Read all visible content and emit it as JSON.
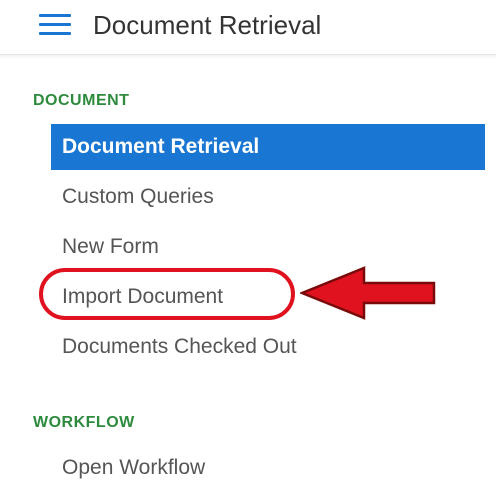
{
  "header": {
    "title": "Document Retrieval",
    "menu_icon": "hamburger-menu-icon"
  },
  "sections": [
    {
      "heading": "DOCUMENT",
      "items": [
        {
          "label": "Document Retrieval",
          "active": true
        },
        {
          "label": "Custom Queries",
          "active": false
        },
        {
          "label": "New Form",
          "active": false
        },
        {
          "label": "Import Document",
          "active": false
        },
        {
          "label": "Documents Checked Out",
          "active": false
        }
      ]
    },
    {
      "heading": "WORKFLOW",
      "items": [
        {
          "label": "Open Workflow",
          "active": false
        }
      ]
    }
  ],
  "annotation": {
    "highlight_color": "#e0121f",
    "arrow_fill": "#e0121f",
    "arrow_stroke": "#7a0a0a",
    "target_item": "Import Document"
  },
  "colors": {
    "accent": "#1976d2",
    "section_heading": "#2e8b3e",
    "item_text": "#555555"
  }
}
